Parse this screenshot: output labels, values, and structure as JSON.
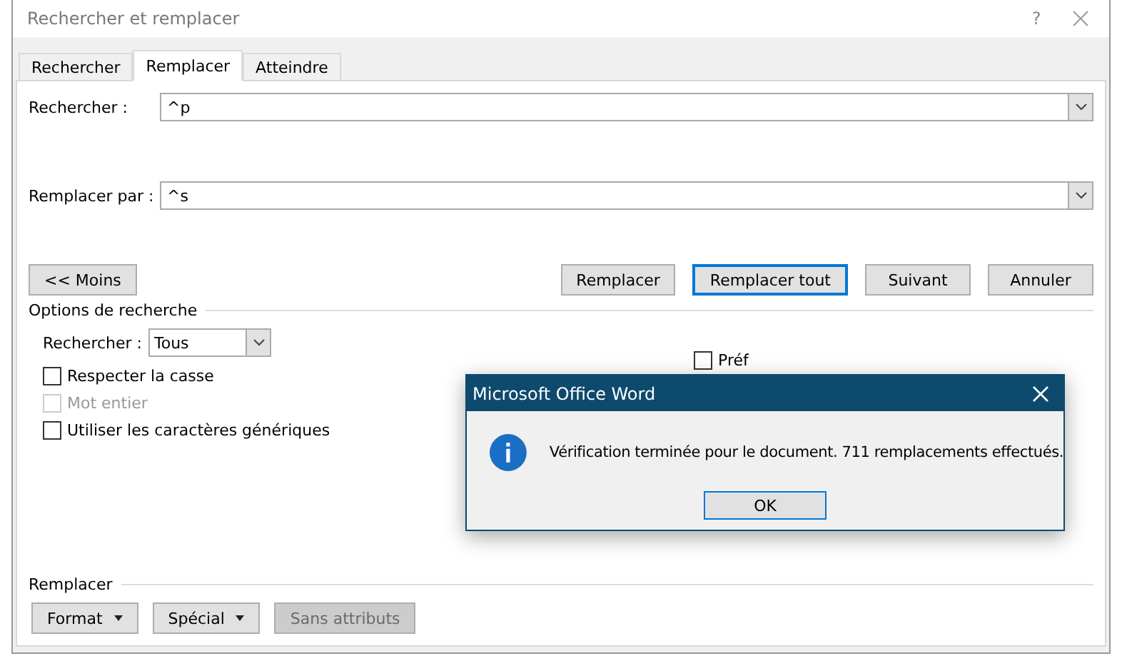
{
  "window": {
    "title": "Rechercher et remplacer",
    "help": "?"
  },
  "tabs": [
    {
      "label": "Rechercher",
      "selected": false
    },
    {
      "label": "Remplacer",
      "selected": true
    },
    {
      "label": "Atteindre",
      "selected": false
    }
  ],
  "fields": [
    {
      "label": "Rechercher :",
      "value": "^p"
    },
    {
      "label": "Remplacer par :",
      "value": "^s"
    }
  ],
  "less_button": "<< Moins",
  "actions": [
    {
      "label": "Remplacer",
      "default": false
    },
    {
      "label": "Remplacer tout",
      "default": true
    },
    {
      "label": "Suivant",
      "default": false
    },
    {
      "label": "Annuler",
      "default": false
    }
  ],
  "options": {
    "title": "Options de recherche",
    "direction": {
      "label": "Rechercher :",
      "value": "Tous"
    },
    "checkboxes": [
      {
        "label": "Respecter la casse",
        "checked": false,
        "disabled": false
      },
      {
        "label": "Mot entier",
        "checked": false,
        "disabled": true
      },
      {
        "label": "Utiliser les caractères génériques",
        "checked": false,
        "disabled": false
      }
    ],
    "right_checkboxes": [
      {
        "label": "Préf",
        "checked": false,
        "disabled": false
      }
    ]
  },
  "replace_section": {
    "title": "Remplacer",
    "buttons": [
      {
        "label": "Format",
        "kind": "menu",
        "disabled": false
      },
      {
        "label": "Spécial",
        "kind": "menu",
        "disabled": false
      },
      {
        "label": "Sans attributs",
        "kind": "plain",
        "disabled": true
      }
    ]
  },
  "message_box": {
    "title": "Microsoft Office Word",
    "message": "Vérification terminée pour le document. 711 remplacements effectués.",
    "button": "OK"
  }
}
